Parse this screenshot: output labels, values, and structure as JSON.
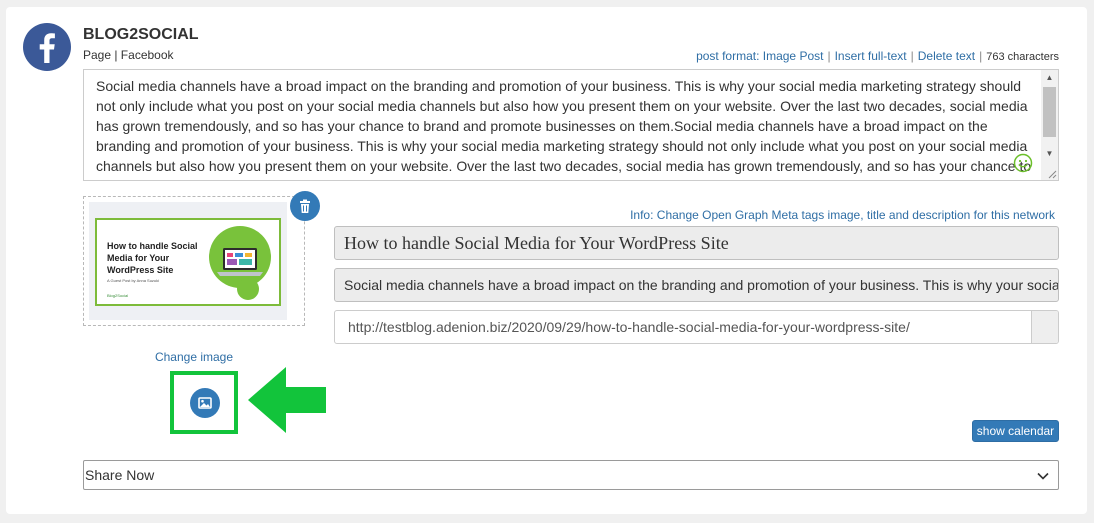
{
  "network": {
    "name": "BLOG2SOCIAL",
    "subtitle": "Page | Facebook",
    "icon": "facebook-icon",
    "brand_color": "#3b5998"
  },
  "toolbar": {
    "post_format": "post format: Image Post",
    "insert_full_text": "Insert full-text",
    "delete_text": "Delete text",
    "separator": "|",
    "char_count": "763 characters"
  },
  "post": {
    "text": "Social media channels have a broad impact on the branding and promotion of your business. This is why your social media marketing strategy should not only include what you post on your social media channels but also how you present them on your website. Over the last two decades, social media has grown tremendously, and so has your chance to brand and promote businesses on them.Social media channels have a broad impact on the branding and promotion of your business. This is why your social media marketing strategy should not only include what you post on your social media channels but also how you present them on your website. Over the last two decades, social media has grown tremendously, and so has your chance to brand and promote businesses on them."
  },
  "image": {
    "thumb_title": "How to handle Social Media for Your WordPress Site",
    "thumb_subtitle": "A Guest Post by Anna Suzuki",
    "thumb_logo": "Blog2Social",
    "change_label": "Change image",
    "accent_color": "#12c43b"
  },
  "og": {
    "info": "Info: Change Open Graph Meta tags image, title and description for this network",
    "title": "How to handle Social Media for Your WordPress Site",
    "description": "Social media channels have a broad impact on the branding and promotion of your business. This is why your social media marketing strategy should not only include what you post on your social media channels",
    "url": "http://testblog.adenion.biz/2020/09/29/how-to-handle-social-media-for-your-wordpress-site/"
  },
  "actions": {
    "show_calendar": "show calendar",
    "share_option": "Share Now",
    "button_color": "#337ab7"
  }
}
